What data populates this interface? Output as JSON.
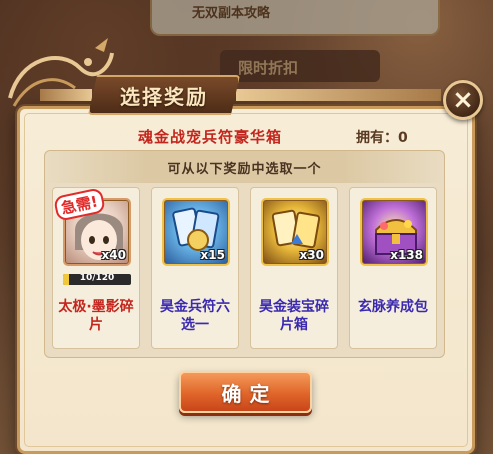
{
  "background": {
    "top_card_text": "无双副本攻略",
    "behind_tab_label": "限时折扣"
  },
  "dialog": {
    "title": "选择奖励",
    "close_symbol": "×",
    "item_name": "魂金战宠兵符豪华箱",
    "owned_label": "拥有：0",
    "subtitle": "可从以下奖励中选取一个",
    "confirm_label": "确定"
  },
  "rewards": [
    {
      "name": "太极·墨影碎片",
      "icon": "character-portrait-icon",
      "count": "x40",
      "badge": "急需!",
      "progress_text": "10/120",
      "progress_fraction": 0.083,
      "label_color": "#c3261e"
    },
    {
      "name": "昊金兵符六选一",
      "icon": "weapon-talisman-card-icon",
      "count": "x15",
      "label_color": "#3a2ab0"
    },
    {
      "name": "昊金装宝碎片箱",
      "icon": "treasure-card-icon",
      "count": "x30",
      "label_color": "#3a2ab0"
    },
    {
      "name": "玄脉养成包",
      "icon": "treasure-chest-icon",
      "count": "x138",
      "label_color": "#3a2ab0"
    }
  ],
  "colors": {
    "accent_gold": "#e8c894",
    "title_red": "#c3261e",
    "confirm_orange": "#e0652a"
  }
}
